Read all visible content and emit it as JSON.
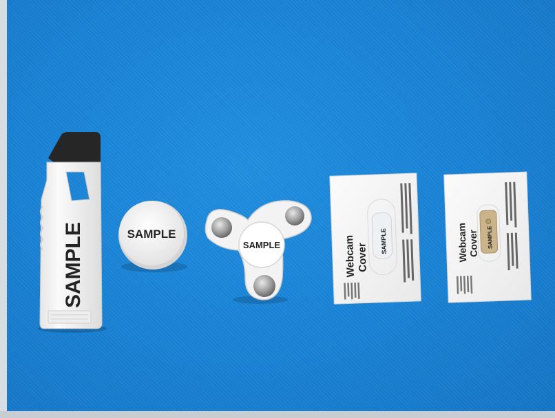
{
  "photo": {
    "background_color": "#1a84d8",
    "products": [
      {
        "name": "phone-stand",
        "label": "SAMPLE",
        "cap_color": "#2a2a2a",
        "body_color": "#f4f4f4"
      },
      {
        "name": "round-disc",
        "label": "SAMPLE"
      },
      {
        "name": "fidget-spinner",
        "label": "SAMPLE"
      },
      {
        "name": "webcam-cover-card-1",
        "title_line1": "Webcam",
        "title_line2": "Cover",
        "label": "SAMPLE",
        "slider_color": "#e8ecef"
      },
      {
        "name": "webcam-cover-card-2",
        "title_line1": "Webcam",
        "title_line2": "Cover",
        "label": "SAMPLE",
        "slider_color": "#cbb48a"
      }
    ]
  }
}
